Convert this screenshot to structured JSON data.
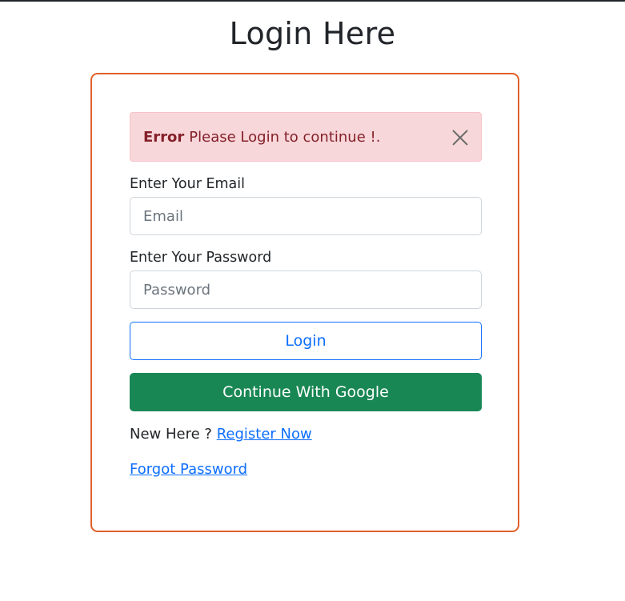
{
  "page": {
    "title": "Login Here"
  },
  "alert": {
    "strong": "Error",
    "message": "Please Login to continue !."
  },
  "form": {
    "email_label": "Enter Your Email",
    "email_placeholder": "Email",
    "email_value": "",
    "password_label": "Enter Your Password",
    "password_placeholder": "Password",
    "password_value": "",
    "login_button": "Login",
    "google_button": "Continue With Google"
  },
  "footer": {
    "new_here_text": "New Here ?",
    "register_link": "Register Now",
    "forgot_link": "Forgot Password"
  },
  "colors": {
    "card_border": "#e0602b",
    "alert_bg": "#f8d7da",
    "alert_text": "#842029",
    "primary": "#0d6efd",
    "success": "#198754"
  },
  "icons": {
    "alert_close": "close-icon"
  }
}
